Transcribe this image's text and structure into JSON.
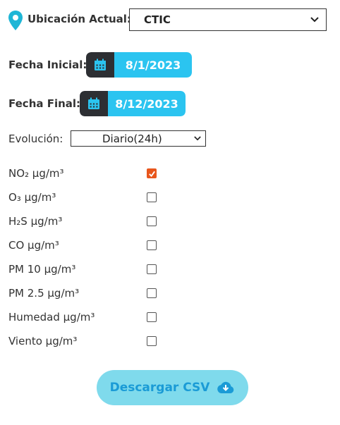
{
  "location": {
    "label": "Ubicación Actual:",
    "selected": "CTIC"
  },
  "fecha_inicial": {
    "label": "Fecha Inicial:",
    "value": "8/1/2023"
  },
  "fecha_final": {
    "label": "Fecha Final:",
    "value": "8/12/2023"
  },
  "evolucion": {
    "label": "Evolución:",
    "selected": "Diario(24h)"
  },
  "parameters": [
    {
      "label": "NO₂ µg/m³",
      "checked": true
    },
    {
      "label": "O₃ µg/m³",
      "checked": false
    },
    {
      "label": "H₂S µg/m³",
      "checked": false
    },
    {
      "label": "CO µg/m³",
      "checked": false
    },
    {
      "label": "PM 10 µg/m³",
      "checked": false
    },
    {
      "label": "PM 2.5 µg/m³",
      "checked": false
    },
    {
      "label": "Humedad µg/m³",
      "checked": false
    },
    {
      "label": "Viento µg/m³",
      "checked": false
    }
  ],
  "download": {
    "label": "Descargar CSV",
    "icon": "cloud-download-icon"
  },
  "colors": {
    "accent": "#2bc4f0",
    "pin": "#1fb6d6",
    "checked": "#e8561c",
    "button_bg": "#7fdaec",
    "button_text": "#1a9bd6"
  }
}
